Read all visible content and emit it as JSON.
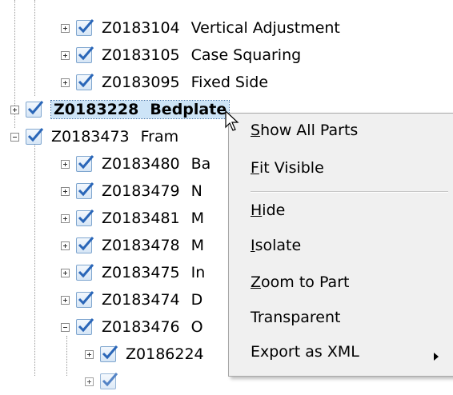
{
  "tree": {
    "rows": [
      {
        "code": "Z0183104",
        "name": "Vertical Adjustment"
      },
      {
        "code": "Z0183105",
        "name": "Case Squaring"
      },
      {
        "code": "Z0183095",
        "name": "Fixed Side"
      },
      {
        "code": "Z0183228",
        "name": "Bedplate"
      },
      {
        "code": "Z0183473",
        "name": "Fram"
      },
      {
        "code": "Z0183480",
        "name": "Ba"
      },
      {
        "code": "Z0183479",
        "name": "N"
      },
      {
        "code": "Z0183481",
        "name": "M"
      },
      {
        "code": "Z0183478",
        "name": "M"
      },
      {
        "code": "Z0183475",
        "name": "In"
      },
      {
        "code": "Z0183474",
        "name": "D"
      },
      {
        "code": "Z0183476",
        "name": "O"
      },
      {
        "code": "Z0186224",
        "name": ""
      }
    ]
  },
  "context_menu": {
    "items": [
      {
        "accel": "S",
        "rest": "how All Parts"
      },
      {
        "accel": "F",
        "rest": "it Visible"
      },
      {
        "accel": "H",
        "rest": "ide"
      },
      {
        "accel": "I",
        "rest": "solate"
      },
      {
        "accel": "Z",
        "rest": "oom to Part"
      },
      {
        "accel": "",
        "rest": "Transparent"
      },
      {
        "accel": "",
        "rest": "Export as XML"
      }
    ]
  },
  "colors": {
    "selection": "#cde4f7",
    "checkmark": "#2a66b8",
    "menu_bg": "#f0f0f0"
  }
}
